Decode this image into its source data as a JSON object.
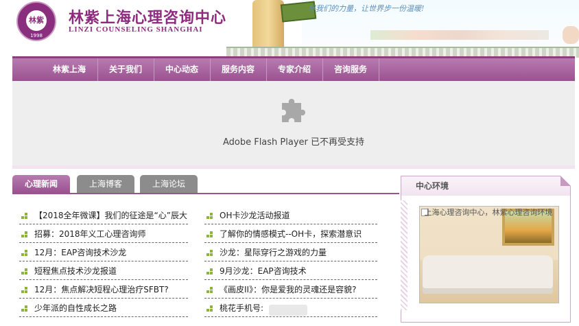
{
  "header": {
    "brand_cn": "林紫上海心理咨询中心",
    "brand_en": "LINZI COUNSELING SHANGHAI",
    "seal_text": "林紫",
    "seal_year": "1998",
    "slogan": "尽我们的力量，让世界步一份温暖!"
  },
  "nav": {
    "items": [
      {
        "label": "林紫上海"
      },
      {
        "label": "关于我们"
      },
      {
        "label": "中心动态"
      },
      {
        "label": "服务内容"
      },
      {
        "label": "专家介绍"
      },
      {
        "label": "咨询服务"
      }
    ]
  },
  "flash": {
    "message": "Adobe Flash Player 已不再受支持",
    "icon": "puzzle-icon"
  },
  "tabs": [
    {
      "label": "心理新闻",
      "active": true
    },
    {
      "label": "上海博客",
      "active": false
    },
    {
      "label": "上海论坛",
      "active": false
    }
  ],
  "news_left": [
    "【2018全年微课】我们的征途是“心”辰大",
    "招募：2018年义工心理咨询师",
    "12月：EAP咨询技术沙龙",
    "短程焦点技术沙龙报道",
    "12月：焦点解决短程心理治疗SFBT?",
    "少年派的自性成长之路"
  ],
  "news_right": [
    "OH卡沙龙活动报道",
    "了解你的情感模式--OH卡，探索潜意识",
    "沙龙：星际穿行之游戏的力量",
    "9月沙龙：EAP咨询技术",
    "《画皮II》：你是爱我的灵魂还是容貌?",
    "桃花手机号:"
  ],
  "env_panel": {
    "title": "中心环境",
    "photo_alt": "上海心理咨询中心，林紫心理咨询环境"
  },
  "colors": {
    "brand_purple": "#8e2b7e",
    "nav_purple": "#9a5290",
    "bullet_green": "#8bb43c"
  }
}
